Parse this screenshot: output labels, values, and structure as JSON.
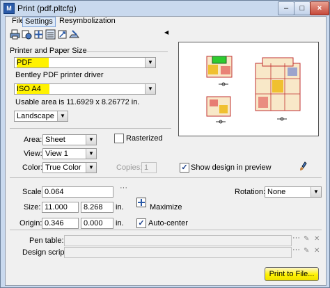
{
  "window": {
    "title": "Print (pdf.pltcfg)"
  },
  "menu": [
    "File",
    "Settings",
    "Resymbolization"
  ],
  "toolbar": {
    "icons": [
      "print-icon",
      "properties-icon",
      "fit-icon",
      "settings-icon",
      "expand-icon",
      "plot-icon"
    ]
  },
  "printer_section": {
    "heading": "Printer and Paper Size",
    "printer": "PDF",
    "driver": "Bentley PDF printer driver",
    "paper": "ISO A4",
    "usable_area": "Usable area is 11.6929 x 8.26772 in.",
    "orientation": "Landscape"
  },
  "area_section": {
    "area_label": "Area:",
    "area_value": "Sheet",
    "rasterized_label": "Rasterized",
    "rasterized_checked": false,
    "view_label": "View:",
    "view_value": "View 1",
    "color_label": "Color:",
    "color_value": "True Color",
    "copies_label": "Copies:",
    "copies_value": "1",
    "show_design_label": "Show design in preview",
    "show_design_checked": true
  },
  "scale_section": {
    "scale_label": "Scale:",
    "scale_value": "0.064",
    "rotation_label": "Rotation:",
    "rotation_value": "None",
    "size_label": "Size:",
    "size_w": "11.000",
    "size_h": "8.268",
    "size_unit": "in.",
    "maximize_label": "Maximize",
    "origin_label": "Origin:",
    "origin_x": "0.346",
    "origin_y": "0.000",
    "origin_unit": "in.",
    "autocenter_label": "Auto-center",
    "autocenter_checked": true
  },
  "tables": {
    "pen_table_label": "Pen table:",
    "pen_table_value": "",
    "design_script_label": "Design script:",
    "design_script_value": ""
  },
  "print_button": "Print to File...",
  "colors": {
    "highlight": "#fff200",
    "window_frame": "#c9d9ee"
  }
}
